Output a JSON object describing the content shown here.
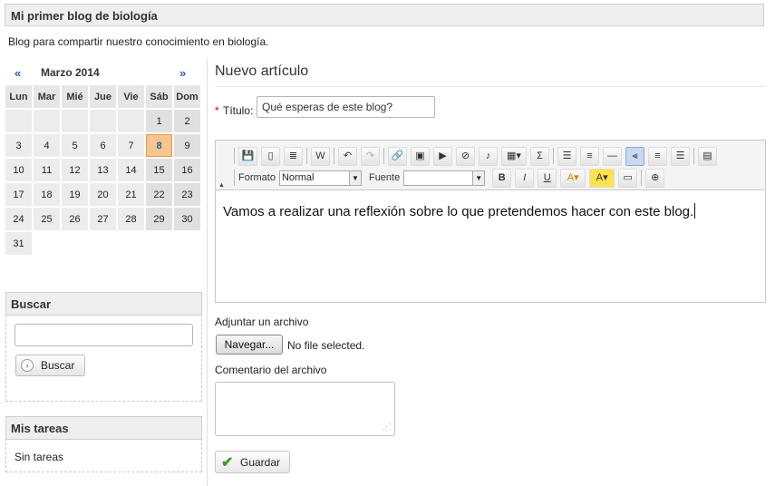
{
  "blog": {
    "title": "Mi primer blog de biología",
    "description": "Blog para compartir nuestro conocimiento en biología."
  },
  "calendar": {
    "prev": "«",
    "next": "»",
    "month_label": "Marzo 2014",
    "weekdays": [
      "Lun",
      "Mar",
      "Mié",
      "Jue",
      "Vie",
      "Sáb",
      "Dom"
    ],
    "weeks": [
      [
        "",
        "",
        "",
        "",
        "",
        "1",
        "2"
      ],
      [
        "3",
        "4",
        "5",
        "6",
        "7",
        "8",
        "9"
      ],
      [
        "10",
        "11",
        "12",
        "13",
        "14",
        "15",
        "16"
      ],
      [
        "17",
        "18",
        "19",
        "20",
        "21",
        "22",
        "23"
      ],
      [
        "24",
        "25",
        "26",
        "27",
        "28",
        "29",
        "30"
      ],
      [
        "31",
        "",
        "",
        "",
        "",
        "",
        ""
      ]
    ],
    "today": "8"
  },
  "search": {
    "heading": "Buscar",
    "button_label": "Buscar",
    "value": ""
  },
  "tasks": {
    "heading": "Mis tareas",
    "empty_text": "Sin tareas"
  },
  "article": {
    "heading": "Nuevo artículo",
    "required_mark": "*",
    "title_label": "Título:",
    "title_value": "Qué esperas de este blog?",
    "editor": {
      "format_label": "Formato",
      "format_value": "Normal",
      "font_label": "Fuente",
      "font_value": "",
      "toolbar_icons": [
        "save-icon",
        "new-page-icon",
        "templates-icon",
        "paste-word-icon",
        "undo-icon",
        "redo-icon",
        "link-icon",
        "image-icon",
        "video-icon",
        "flash-icon",
        "audio-icon",
        "table-icon",
        "formula-icon",
        "bullet-list-icon",
        "numbered-list-icon",
        "horizontal-rule-icon",
        "align-left-icon",
        "align-center-icon",
        "justify-icon",
        "source-icon",
        "bold-icon",
        "italic-icon",
        "underline-icon",
        "text-color-icon",
        "bg-color-icon",
        "paste-text-icon",
        "maximize-icon"
      ],
      "body_text": "Vamos a realizar una reflexión sobre lo que pretendemos hacer con este blog."
    },
    "attach_label": "Adjuntar un archivo",
    "browse_button": "Navegar...",
    "no_file_text": "No file selected.",
    "comment_label": "Comentario del archivo",
    "comment_value": "",
    "save_button": "Guardar"
  },
  "colors": {
    "today_bg": "#f7c58e",
    "link_blue": "#2a5db0",
    "save_check": "#3a9a2a"
  }
}
